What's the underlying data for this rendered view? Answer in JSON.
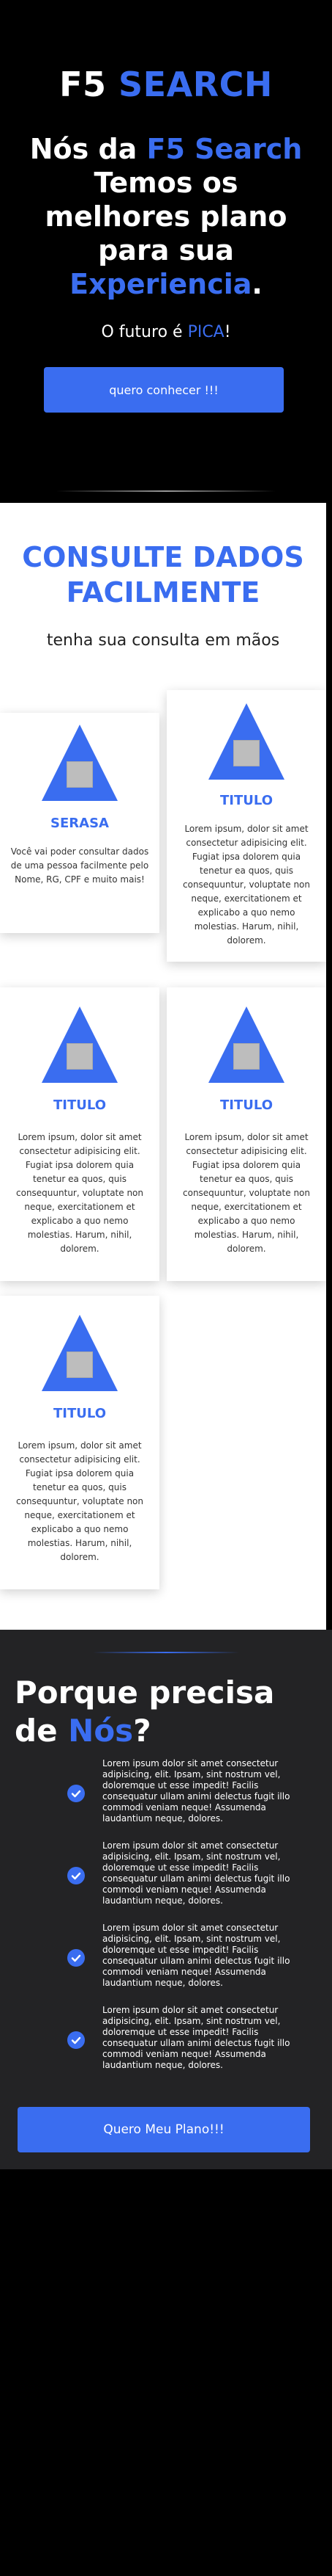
{
  "hero": {
    "brand_prefix": "F5",
    "brand_accent": "SEARCH",
    "title_1": "Nós da ",
    "title_accent_1": "F5 Search",
    "title_2": " Temos os melhores plano para sua ",
    "title_accent_2": "Experiencia",
    "title_3": ".",
    "tagline_prefix": "O futuro é ",
    "tagline_accent": "PICA",
    "tagline_suffix": "!",
    "cta_label": "quero conhecer !!!"
  },
  "consult": {
    "title": "CONSULTE DADOS FACILMENTE",
    "subtitle": "tenha sua consulta em mãos",
    "cards": [
      {
        "title": "SERASA",
        "text": "Você vai poder consultar dados de uma pessoa facilmente pelo Nome, RG, CPF e muito mais!"
      },
      {
        "title": "TITULO",
        "text": "Lorem ipsum, dolor sit amet consectetur adipisicing elit. Fugiat ipsa dolorem quia tenetur ea quos, quis consequuntur, voluptate non neque, exercitationem et explicabo a quo nemo molestias. Harum, nihil, dolorem."
      },
      {
        "title": "TITULO",
        "text": "Lorem ipsum, dolor sit amet consectetur adipisicing elit. Fugiat ipsa dolorem quia tenetur ea quos, quis consequuntur, voluptate non neque, exercitationem et explicabo a quo nemo molestias. Harum, nihil, dolorem."
      },
      {
        "title": "TITULO",
        "text": "Lorem ipsum, dolor sit amet consectetur adipisicing elit. Fugiat ipsa dolorem quia tenetur ea quos, quis consequuntur, voluptate non neque, exercitationem et explicabo a quo nemo molestias. Harum, nihil, dolorem."
      },
      {
        "title": "TITULO",
        "text": "Lorem ipsum, dolor sit amet consectetur adipisicing elit. Fugiat ipsa dolorem quia tenetur ea quos, quis consequuntur, voluptate non neque, exercitationem et explicabo a quo nemo molestias. Harum, nihil, dolorem."
      }
    ]
  },
  "why": {
    "title_1": "Porque precisa de ",
    "title_accent": "Nós",
    "title_2": "?",
    "benefits": [
      "Lorem ipsum dolor sit amet consectetur adipisicing, elit. Ipsam, sint nostrum vel, doloremque ut esse impedit! Facilis consequatur ullam animi delectus fugit illo commodi veniam neque! Assumenda laudantium neque, dolores.",
      "Lorem ipsum dolor sit amet consectetur adipisicing, elit. Ipsam, sint nostrum vel, doloremque ut esse impedit! Facilis consequatur ullam animi delectus fugit illo commodi veniam neque! Assumenda laudantium neque, dolores.",
      "Lorem ipsum dolor sit amet consectetur adipisicing, elit. Ipsam, sint nostrum vel, doloremque ut esse impedit! Facilis consequatur ullam animi delectus fugit illo commodi veniam neque! Assumenda laudantium neque, dolores.",
      "Lorem ipsum dolor sit amet consectetur adipisicing, elit. Ipsam, sint nostrum vel, doloremque ut esse impedit! Facilis consequatur ullam animi delectus fugit illo commodi veniam neque! Assumenda laudantium neque, dolores."
    ],
    "button_label": "Quero Meu Plano!!!"
  },
  "icons": {
    "card_icon": "triangle-image-icon",
    "benefit_icon": "check-circle-icon"
  },
  "colors": {
    "accent": "#3a6df0",
    "hero_bg": "#000000",
    "section_bg": "#ffffff",
    "why_bg": "#232325"
  }
}
